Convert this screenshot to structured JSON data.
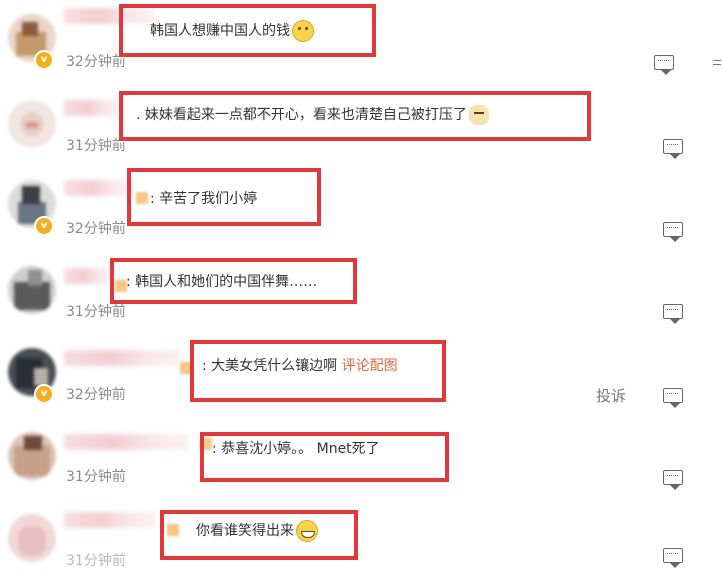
{
  "comments": [
    {
      "text": "韩国人想赚中国人的钱",
      "link": "",
      "emoji": "smile",
      "time": "32分钟前",
      "verified": true
    },
    {
      "text": ". 妹妹看起来一点都不开心，看来也清楚自己被打压了",
      "link": "",
      "emoji": "dog",
      "time": "31分钟前",
      "verified": false
    },
    {
      "text": ": 辛苦了我们小婷",
      "link": "",
      "emoji": "",
      "time": "32分钟前",
      "verified": true
    },
    {
      "text": ": 韩国人和她们的中国伴舞……",
      "link": "",
      "emoji": "",
      "time": "31分钟前",
      "verified": false
    },
    {
      "text": ": 大美女凭什么镶边啊",
      "link": "评论配图",
      "emoji": "",
      "time": "32分钟前",
      "verified": true
    },
    {
      "text": ": 恭喜沈小婷。。 Mnet死了",
      "link": "",
      "emoji": "",
      "time": "31分钟前",
      "verified": false
    },
    {
      "text": "你看谁笑得出来",
      "link": "",
      "emoji": "grin",
      "time": "31分钟前",
      "verified": false
    }
  ],
  "actions": {
    "report_label": "投诉"
  },
  "icons": {
    "comment": "comment-icon",
    "verified": "verified-badge-icon",
    "more": "more-icon"
  },
  "colors": {
    "highlight_box": "#e0393b",
    "link": "#e0673f",
    "time": "#8b8b8b"
  }
}
